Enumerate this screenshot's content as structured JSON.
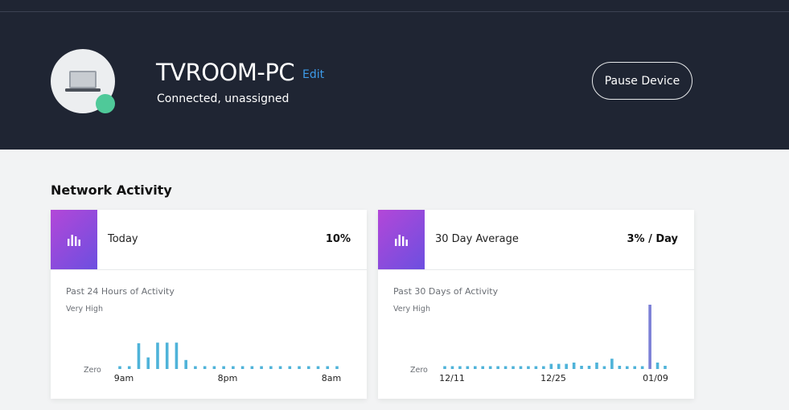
{
  "device": {
    "name": "TVROOM-PC",
    "edit_label": "Edit",
    "status": "Connected, unassigned",
    "pause_label": "Pause Device",
    "avatar_icon": "laptop-icon",
    "status_color": "#4fc999"
  },
  "section_title": "Network Activity",
  "cards": [
    {
      "icon": "bar-chart-icon",
      "label": "Today",
      "value": "10%",
      "chart_title": "Past 24 Hours of Activity",
      "y_high": "Very High",
      "y_low": "Zero",
      "x_labels": [
        "9am",
        "8pm",
        "8am"
      ]
    },
    {
      "icon": "bar-chart-icon",
      "label": "30 Day Average",
      "value": "3% / Day",
      "chart_title": "Past 30 Days of Activity",
      "y_high": "Very High",
      "y_low": "Zero",
      "x_labels": [
        "12/11",
        "12/25",
        "01/09"
      ]
    }
  ],
  "chart_data": [
    {
      "type": "bar",
      "title": "Past 24 Hours of Activity",
      "ylim": [
        "Zero",
        "Very High"
      ],
      "color": "#4fb3d9",
      "x_tick_labels": [
        "9am",
        "8pm",
        "8am"
      ],
      "values": [
        0.04,
        0.04,
        0.4,
        0.18,
        0.41,
        0.41,
        0.41,
        0.14,
        0.04,
        0.04,
        0.04,
        0.04,
        0.04,
        0.04,
        0.04,
        0.04,
        0.04,
        0.04,
        0.04,
        0.04,
        0.04,
        0.04,
        0.04,
        0.04
      ]
    },
    {
      "type": "bar",
      "title": "Past 30 Days of Activity",
      "ylim": [
        "Zero",
        "Very High"
      ],
      "color": "#4fb3d9",
      "highlight_color": "#7b7fd6",
      "highlight_index": 27,
      "x_tick_labels": [
        "12/11",
        "12/25",
        "01/09"
      ],
      "values": [
        0.04,
        0.04,
        0.04,
        0.04,
        0.04,
        0.04,
        0.04,
        0.04,
        0.04,
        0.04,
        0.04,
        0.04,
        0.04,
        0.04,
        0.08,
        0.08,
        0.08,
        0.1,
        0.05,
        0.05,
        0.1,
        0.04,
        0.16,
        0.05,
        0.04,
        0.04,
        0.04,
        1.0,
        0.1,
        0.05
      ]
    }
  ]
}
